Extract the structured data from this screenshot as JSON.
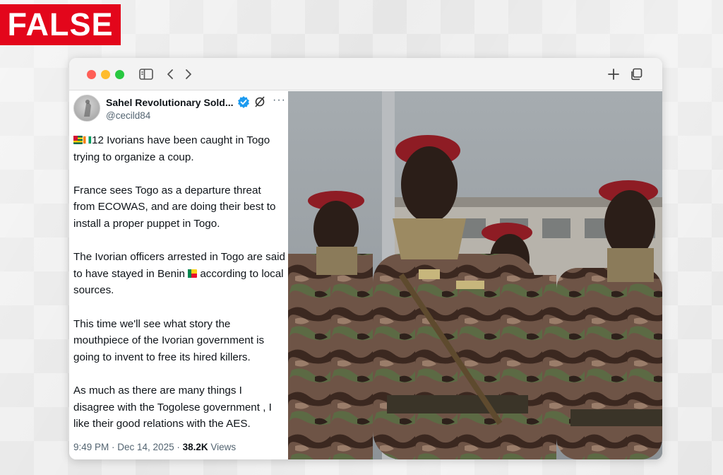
{
  "stamp": {
    "label": "FALSE",
    "color": "#e3061b"
  },
  "browser": {
    "traffic_lights": [
      "close",
      "minimize",
      "zoom"
    ],
    "icons": [
      "sidebar-icon",
      "back-icon",
      "forward-icon",
      "new-tab-icon",
      "tabs-overview-icon"
    ]
  },
  "tweet": {
    "author_name": "Sahel Revolutionary Sold...",
    "handle": "@cecild84",
    "paragraphs": [
      {
        "flags": [
          "togo",
          "ivory-coast"
        ],
        "text": "12 Ivorians have been caught in Togo trying to organize a coup."
      },
      {
        "text": "France sees Togo as a departure threat from ECOWAS, and are doing their best to install a proper puppet in Togo."
      },
      {
        "text_before_flag": "The Ivorian officers arrested in Togo are said to have stayed in Benin",
        "flag": "benin",
        "text_after_flag": "according to local sources."
      },
      {
        "text": "This time we'll see what story the mouthpiece of the Ivorian government is going to invent to free its hired killers."
      },
      {
        "text": "As much as there are many things I disagree with the Togolese government , I like their good relations with the AES."
      }
    ],
    "timestamp": "9:49 PM · Dec 14, 2025 · ",
    "views_count": "38.2K",
    "views_label": " Views"
  },
  "photo": {
    "description_icon": "soldiers-photo",
    "accent_colors": {
      "beret": "#8e1c24",
      "camo_dark": "#3d2a22",
      "camo_green": "#5a6b45",
      "sky": "#9aa1a6"
    }
  }
}
